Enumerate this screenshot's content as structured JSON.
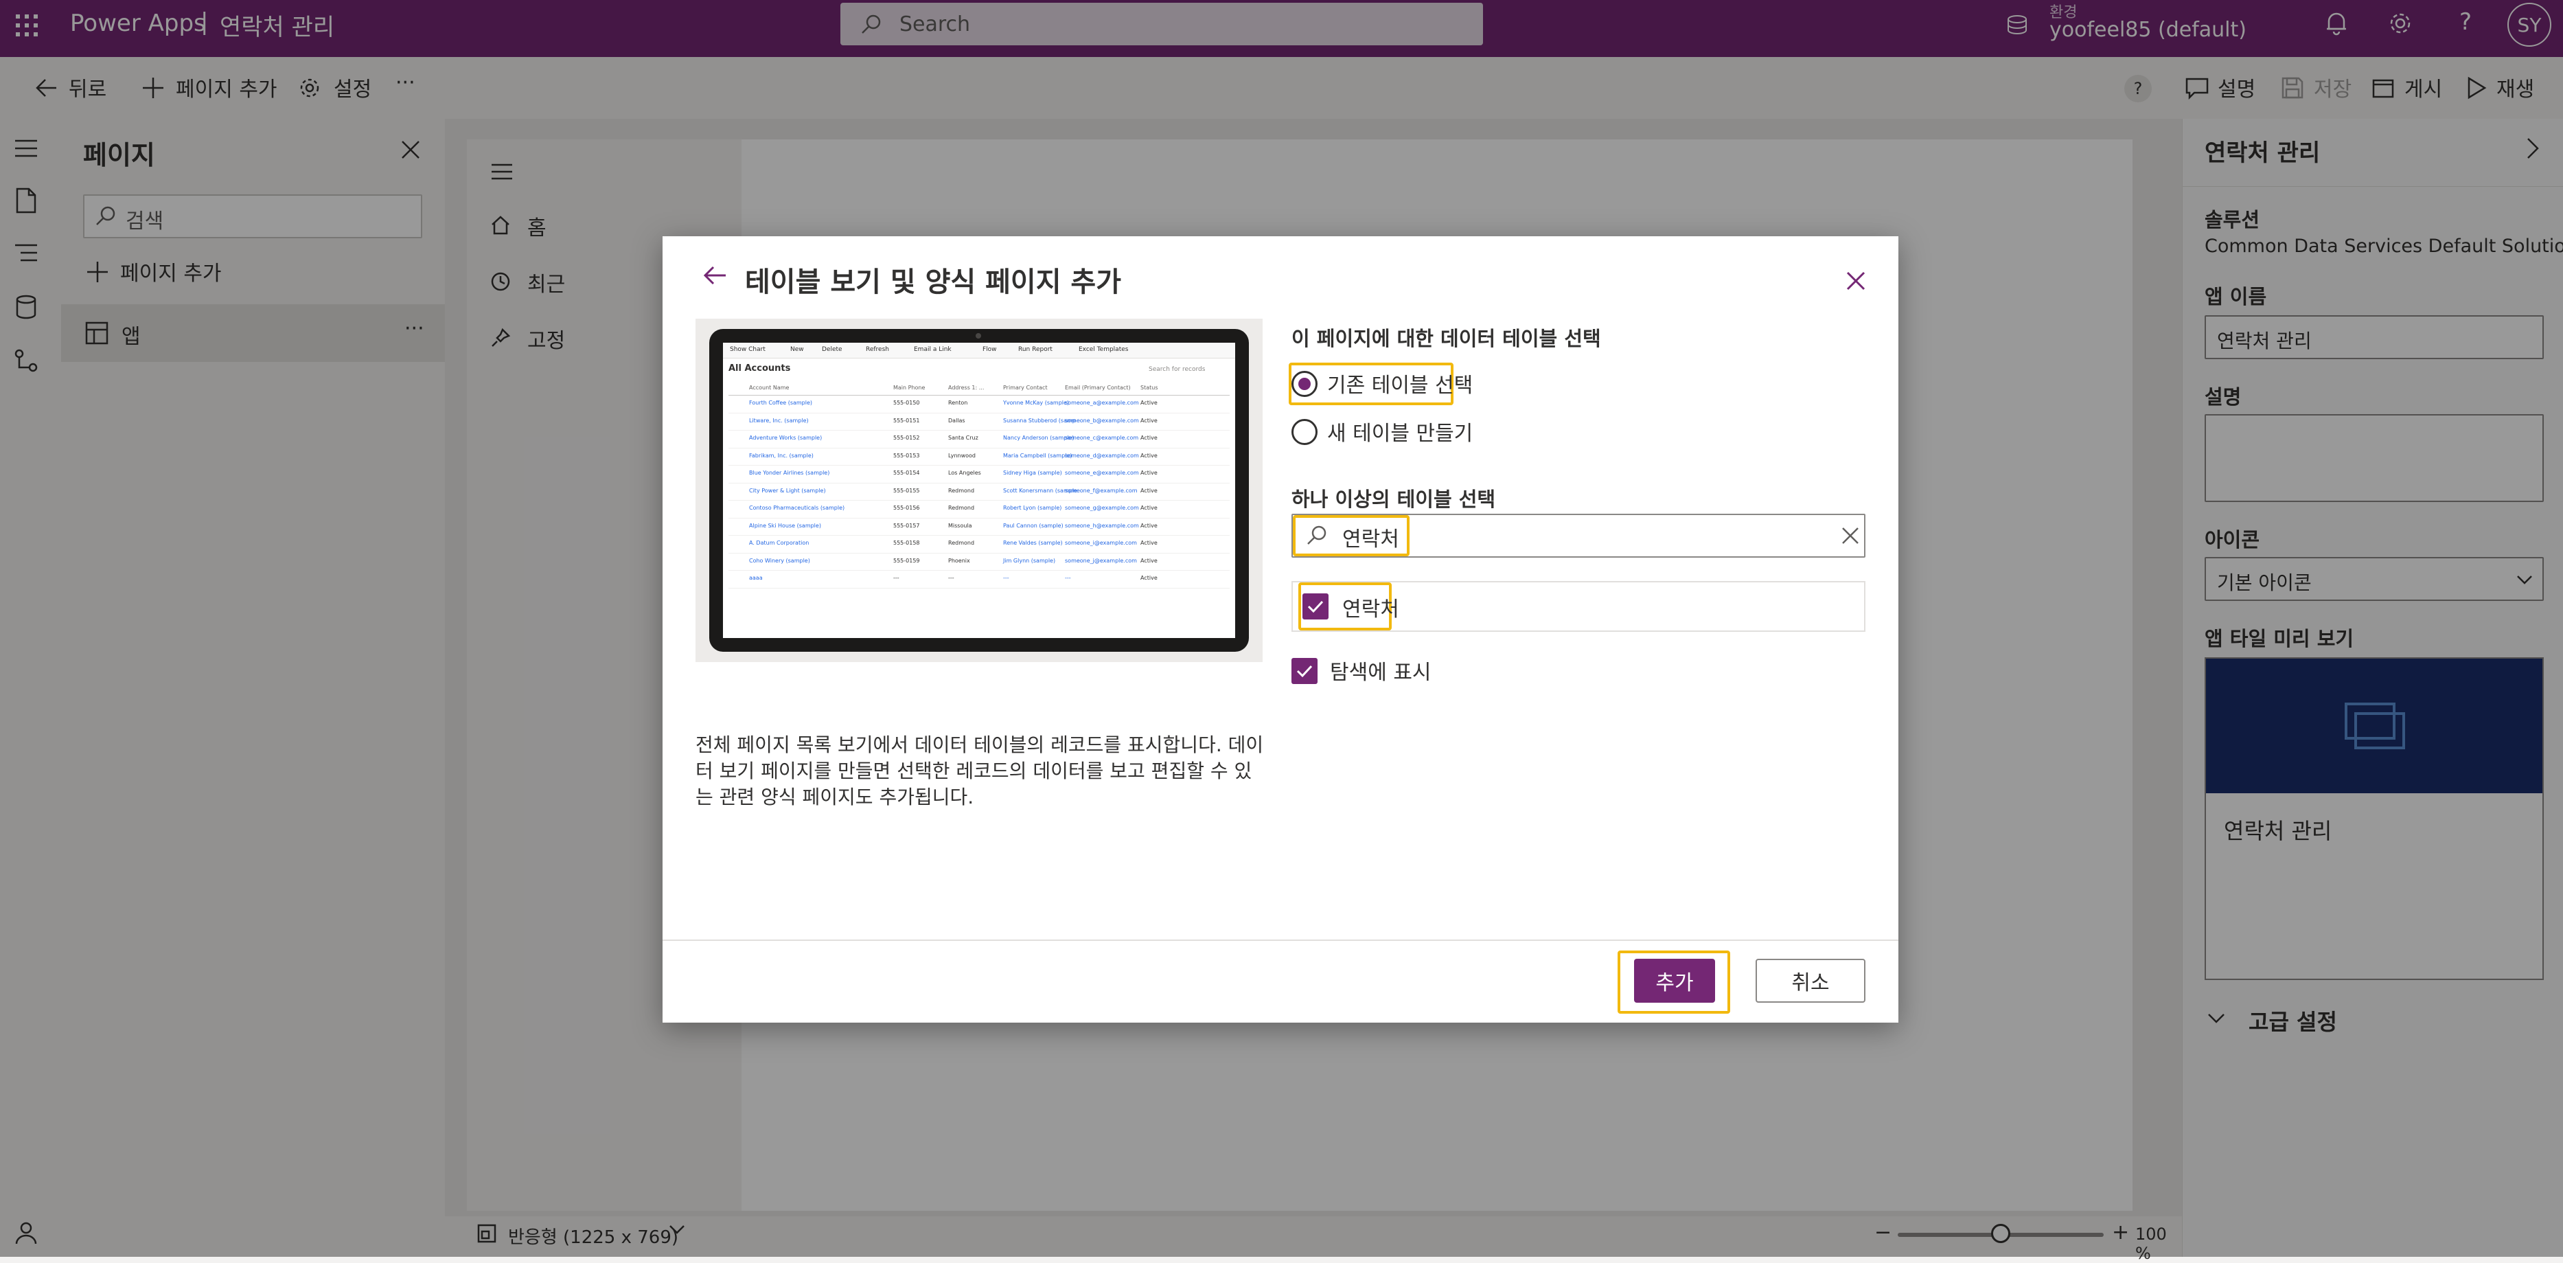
{
  "header": {
    "app_name": "Power Apps",
    "separator": "|",
    "app_title": "연락처 관리",
    "search_placeholder": "Search",
    "env_label": "환경",
    "env_name": "yoofeel85 (default)",
    "avatar_initials": "SY",
    "brand_color": "#742774"
  },
  "command_bar": {
    "back": "뒤로",
    "add_page": "페이지 추가",
    "settings": "설정",
    "more": "···",
    "help": "?",
    "describe": "설명",
    "save": "저장",
    "publish": "게시",
    "play": "재생"
  },
  "pages_panel": {
    "title": "페이지",
    "search_placeholder": "검색",
    "add_page": "페이지 추가",
    "items": [
      {
        "label": "앱",
        "more": "···"
      }
    ]
  },
  "app_nav": {
    "items": [
      {
        "label": "홈"
      },
      {
        "label": "최근"
      },
      {
        "label": "고정"
      }
    ]
  },
  "status_bar": {
    "layout": "반응형 (1225 x 769)",
    "zoom": "100 %",
    "zoom_level": 100
  },
  "right_panel": {
    "title": "연락처 관리",
    "solution_label": "솔루션",
    "solution_value": "Common Data Services Default Solution",
    "app_name_label": "앱 이름",
    "app_name_value": "연락처 관리",
    "description_label": "설명",
    "description_value": "",
    "icon_label": "아이콘",
    "icon_value": "기본 아이콘",
    "tile_preview_label": "앱 타일 미리 보기",
    "tile_title": "연락처 관리",
    "advanced_settings": "고급 설정"
  },
  "dialog": {
    "title": "테이블 보기 및 양식 페이지 추가",
    "description": "전체 페이지 목록 보기에서 데이터 테이블의 레코드를 표시합니다. 데이터 보기 페이지를 만들면 선택한 레코드의 데이터를 보고 편집할 수 있는 관련 양식 페이지도 추가됩니다.",
    "section_title": "이 페이지에 대한 데이터 테이블 선택",
    "radio_existing": "기존 테이블 선택",
    "radio_new": "새 테이블 만들기",
    "multi_select_label": "하나 이상의 테이블 선택",
    "search_value": "연락처",
    "result_item": "연락처",
    "show_in_nav": "탐색에 표시",
    "add_button": "추가",
    "cancel_button": "취소",
    "preview": {
      "toolbar": [
        "Show Chart",
        "New",
        "Delete",
        "Refresh",
        "Email a Link",
        "Flow",
        "Run Report",
        "Excel Templates"
      ],
      "view_title": "All Accounts",
      "search_hint": "Search for records",
      "columns": [
        "Account Name",
        "Main Phone",
        "Address 1: ...",
        "Primary Contact",
        "Email (Primary Contact)",
        "Status"
      ],
      "rows": [
        [
          "Fourth Coffee (sample)",
          "555-0150",
          "Renton",
          "Yvonne McKay (sample)",
          "someone_a@example.com",
          "Active"
        ],
        [
          "Litware, Inc. (sample)",
          "555-0151",
          "Dallas",
          "Susanna Stubberod (samp",
          "someone_b@example.com",
          "Active"
        ],
        [
          "Adventure Works (sample)",
          "555-0152",
          "Santa Cruz",
          "Nancy Anderson (sample)",
          "someone_c@example.com",
          "Active"
        ],
        [
          "Fabrikam, Inc. (sample)",
          "555-0153",
          "Lynnwood",
          "Maria Campbell (sample)",
          "someone_d@example.com",
          "Active"
        ],
        [
          "Blue Yonder Airlines (sample)",
          "555-0154",
          "Los Angeles",
          "Sidney Higa (sample)",
          "someone_e@example.com",
          "Active"
        ],
        [
          "City Power & Light (sample)",
          "555-0155",
          "Redmond",
          "Scott Konersmann (sample",
          "someone_f@example.com",
          "Active"
        ],
        [
          "Contoso Pharmaceuticals (sample)",
          "555-0156",
          "Redmond",
          "Robert Lyon (sample)",
          "someone_g@example.com",
          "Active"
        ],
        [
          "Alpine Ski House (sample)",
          "555-0157",
          "Missoula",
          "Paul Cannon (sample)",
          "someone_h@example.com",
          "Active"
        ],
        [
          "A. Datum Corporation",
          "555-0158",
          "Redmond",
          "Rene Valdes (sample)",
          "someone_i@example.com",
          "Active"
        ],
        [
          "Coho Winery (sample)",
          "555-0159",
          "Phoenix",
          "Jim Glynn (sample)",
          "someone_j@example.com",
          "Active"
        ],
        [
          "aaaa",
          "---",
          "---",
          "---",
          "---",
          "Active"
        ]
      ]
    }
  }
}
